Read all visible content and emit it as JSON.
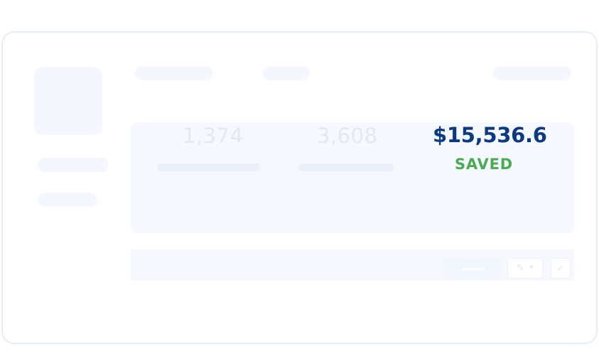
{
  "stats": {
    "stat1_value": "1,374",
    "stat2_value": "3,608",
    "amount": "$15,536.6",
    "amount_status": "SAVED"
  },
  "colors": {
    "amount": "#0b3a83",
    "status": "#4caa53",
    "skeleton": "#f4f7fd",
    "border": "#e6edf9"
  },
  "icons": {
    "edit": "pencil-icon",
    "dropdown": "chevron-down-icon",
    "confirm": "check-icon"
  }
}
